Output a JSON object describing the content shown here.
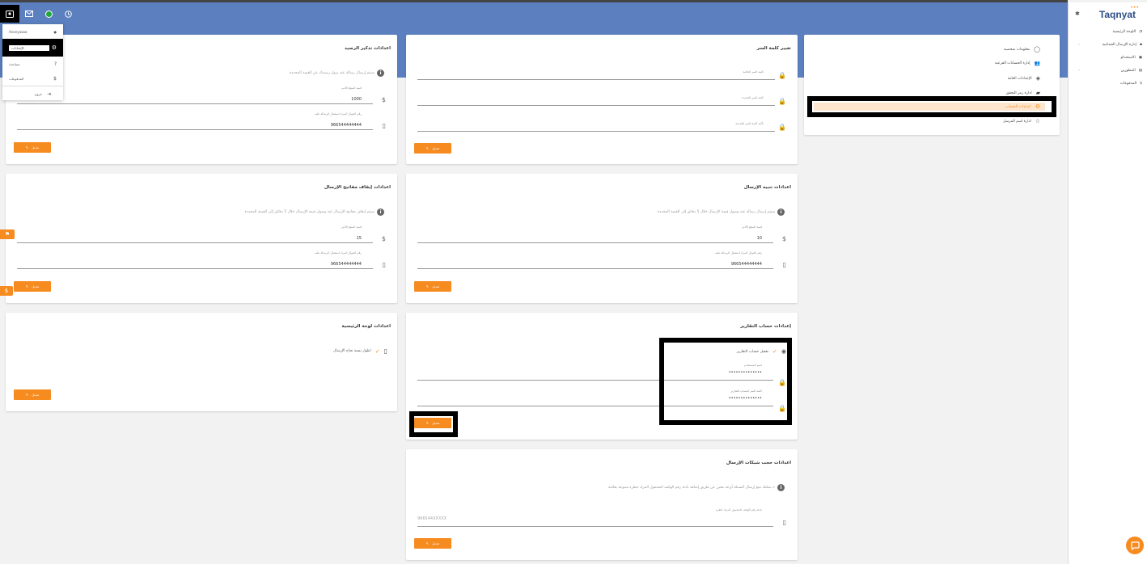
{
  "brand": {
    "name": "Taqnyat",
    "accent": "#f68b1f",
    "primary": "#5b7fbf"
  },
  "topbar": {
    "icons": [
      "profile-icon",
      "mail-icon",
      "status-dot-icon",
      "clock-icon"
    ]
  },
  "user_menu": {
    "items": [
      {
        "label": "Ananyaaaa",
        "icon": "user-icon"
      },
      {
        "label": "الإعدادات",
        "icon": "gear-icon"
      },
      {
        "label": "مساعدة",
        "icon": "help-icon"
      },
      {
        "label": "المدفوعات",
        "icon": "dollar-icon"
      },
      {
        "label": "خروج",
        "icon": "logout-icon"
      }
    ]
  },
  "sidebar": {
    "items": [
      {
        "label": "اللوحة الرئيسية",
        "icon": "dashboard-icon"
      },
      {
        "label": "إدارة الإرسال الجماعية",
        "icon": "message-icon"
      },
      {
        "label": "الاستخدام",
        "icon": "wallet-icon"
      },
      {
        "label": "المطورين",
        "icon": "code-icon"
      },
      {
        "label": "المدفوعات",
        "icon": "dollar-icon"
      }
    ]
  },
  "settings_menu": {
    "items": [
      {
        "label": "معلومات شخصية"
      },
      {
        "label": "إدارة الحسابات الفرعية"
      },
      {
        "label": "الإعدادات العامة"
      },
      {
        "label": "ادارة رمز التحقق"
      },
      {
        "label": "اعدادات الحساب"
      },
      {
        "label": "ادارة اسم المرسل"
      }
    ]
  },
  "edit_label": "تعديل",
  "cards": {
    "balance_reminder": {
      "title": "اعدادات تذكير الرصيد",
      "info": "سيتم إرسال رسالة عند نزول رصيدك عن القيمة المحددة",
      "amount_label": "قيمة المبلغ الأدنى",
      "amount_value": "1000",
      "mobile_label": "رقم الجوال المراد استقبال الرسالة عليه",
      "mobile_value": "966544444444"
    },
    "change_password": {
      "title": "تغيير كلمة السر",
      "current": "كلمة السر الحالية",
      "new": "كلمة السر الجديدة",
      "confirm": "تأكيد كلمة السر الجديدة"
    },
    "stop_keys": {
      "title": "اعدادات إيقاف مفاتيح الإرسال",
      "info": "سيتم ايقاف مفاتيح الإرسال عند وصول قيمة الإرسال خلال 5 دقائق إلى القيمة المحددة",
      "amount_label": "قيمة المبلغ الأدنى",
      "amount_value": "15",
      "mobile_label": "رقم الجوال المراد استقبال الرسالة عليه",
      "mobile_value": "966544444444"
    },
    "send_alert": {
      "title": "اعدادات تنبيه الإرسال",
      "info": "سيتم إرسال رسالة عند وصول قيمة الإرسال خلال 5 دقائق إلى القيمة المحددة",
      "amount_label": "قيمة المبلغ الأدنى",
      "amount_value": "10",
      "mobile_label": "رقم الجوال المراد استقبال الرسالة عليه",
      "mobile_value": "966544444444"
    },
    "dashboard": {
      "title": "اعدادات لوحة الرئيسية",
      "check_label": "اظهار نسبة نجاح الإرسال"
    },
    "reports_account": {
      "title": "إعدادات حساب التقارير",
      "check_label": "تفعيل حساب التقارير",
      "username_label": "اسم المستخدم",
      "username_value": "••••••••••••••",
      "password_label": "كلمة السر لحساب التقارير",
      "password_value": "••••••••••••••"
    },
    "block_networks": {
      "title": "اعدادات حجب شبكات الإرسال",
      "info": "يمكنك منع إرسال الشبكة أو قد معين عن طريق إضافة بادئة رقم الهاتف المحمول المراد حظره متبوعة بعلامة »",
      "field_label": "بادئة رقم الهاتف المحمول المراد حظره",
      "placeholder": "966544XXXXX"
    }
  }
}
